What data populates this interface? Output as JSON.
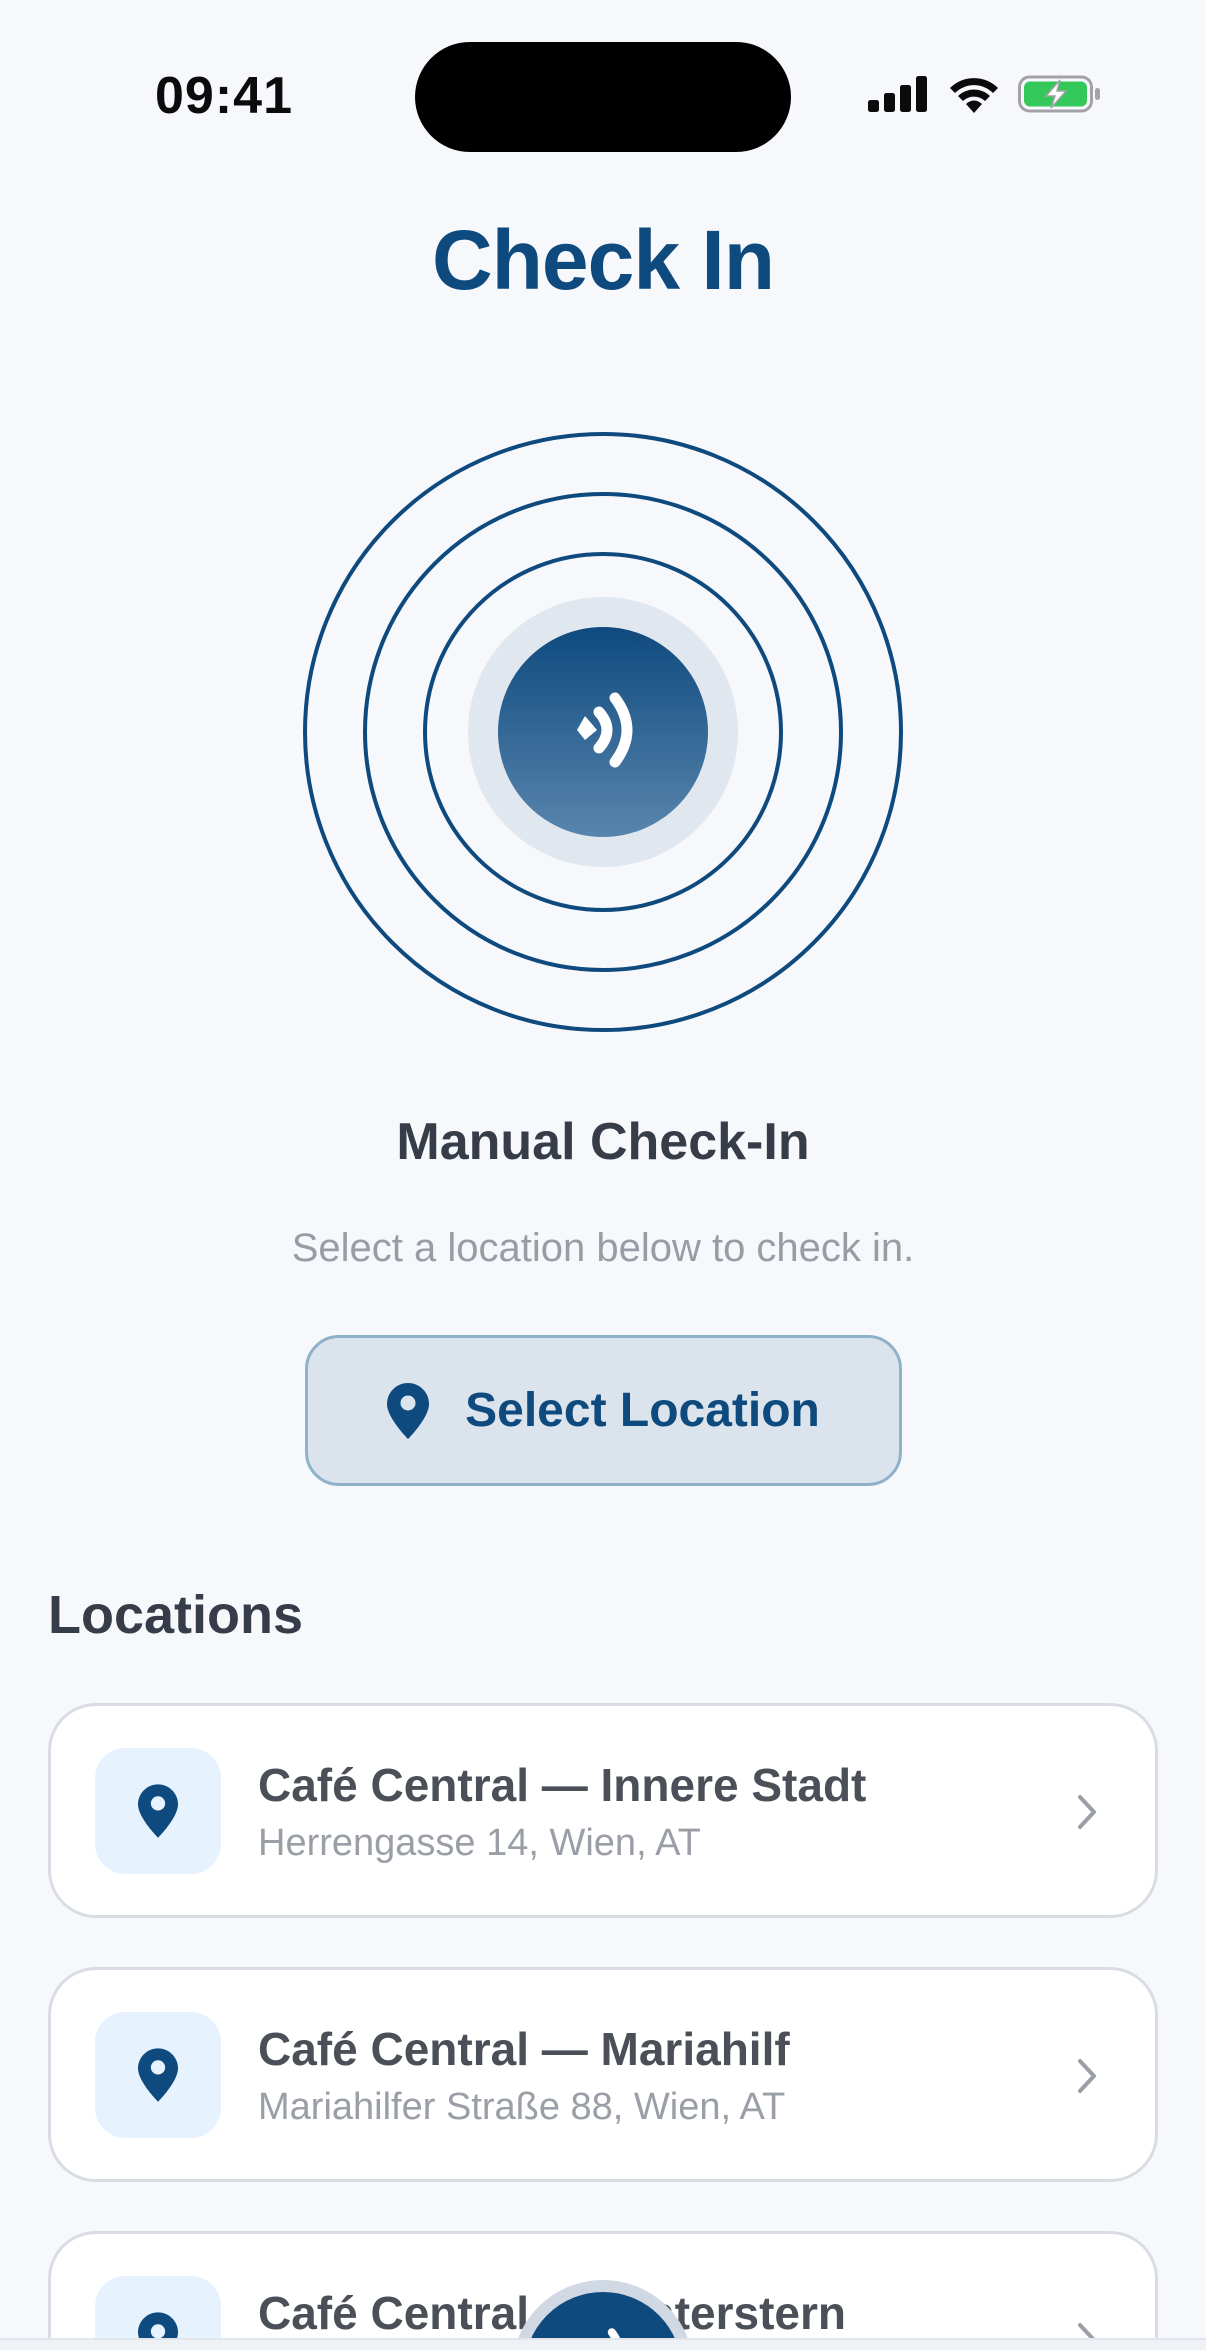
{
  "status_bar": {
    "time": "09:41",
    "icons": [
      "cellular-signal-icon",
      "wifi-icon",
      "battery-charging-icon"
    ]
  },
  "header": {
    "title": "Check In"
  },
  "scanner": {
    "icon": "nfc-contactless-icon"
  },
  "manual": {
    "heading": "Manual Check-In",
    "subtitle": "Select a location below to check in.",
    "button_label": "Select Location",
    "button_icon": "map-pin-icon"
  },
  "locations": {
    "heading": "Locations",
    "items": [
      {
        "name": "Café Central — Innere Stadt",
        "address": "Herrengasse 14, Wien, AT"
      },
      {
        "name": "Café Central — Mariahilf",
        "address": "Mariahilfer Straße 88, Wien, AT"
      },
      {
        "name": "Café Central — Praterstern",
        "address": ""
      }
    ]
  },
  "colors": {
    "primary": "#0f4a7e",
    "background": "#f6f8fb",
    "card": "#ffffff",
    "muted_text": "#989da5",
    "battery_green": "#34c759"
  }
}
